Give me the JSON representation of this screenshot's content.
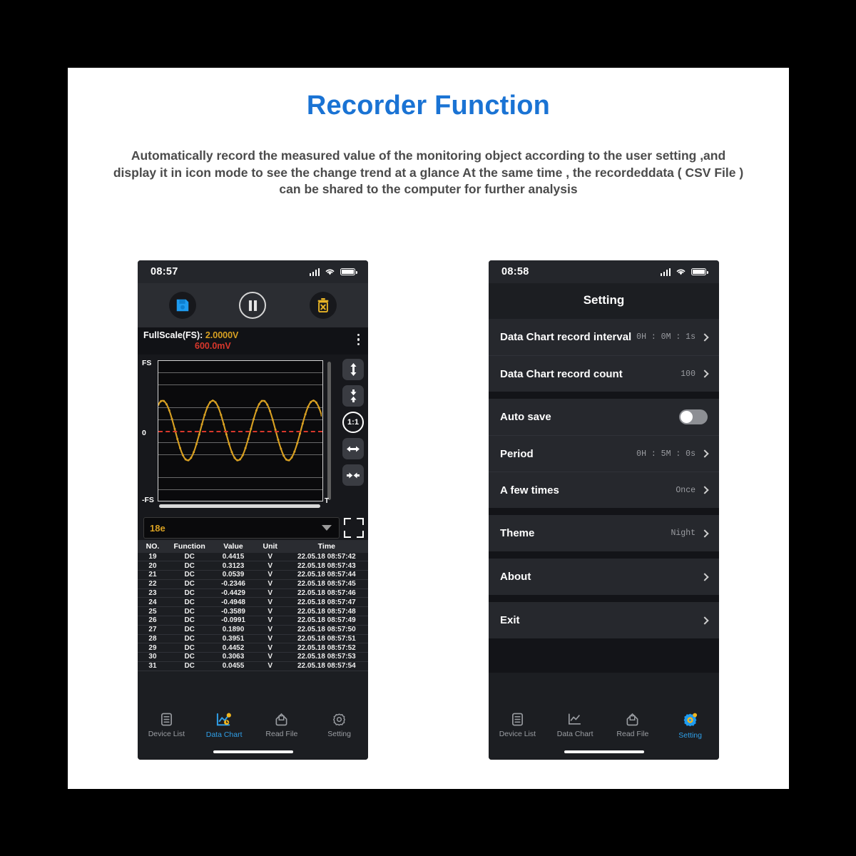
{
  "header": {
    "title": "Recorder Function",
    "description": "Automatically record the measured value of the monitoring object according to the user setting ,and display it in icon mode to see the change trend at a glance At the same time , the recordeddata ( CSV File ) can be shared to the computer for further analysis",
    "title_color": "#1a73d4"
  },
  "phone_left": {
    "status": {
      "time": "08:57",
      "signal_icon": "signal-bars-icon",
      "wifi_icon": "wifi-icon",
      "battery_icon": "battery-icon"
    },
    "toolbar": {
      "save_label": "save-icon",
      "pause_label": "pause-icon",
      "delete_label": "delete-icon"
    },
    "fullscale": {
      "label": "FullScale(FS):",
      "value": "2.0000V",
      "value_color": "#d8a022",
      "sub_value": "600.0mV",
      "sub_color": "#d8372b",
      "menu_icon": "kebab-menu-icon"
    },
    "chart": {
      "y_top": "FS",
      "y_zero": "0",
      "y_bottom": "-FS",
      "x_axis": "T",
      "controls": [
        {
          "name": "vertical-expand-button",
          "glyph": "up-down-arrows-icon"
        },
        {
          "name": "vertical-shrink-button",
          "glyph": "down-up-arrows-icon"
        },
        {
          "name": "ratio-reset-button",
          "glyph": "1:1"
        },
        {
          "name": "horizontal-expand-button",
          "glyph": "left-right-arrows-icon"
        },
        {
          "name": "horizontal-shrink-button",
          "glyph": "right-left-arrows-icon"
        }
      ]
    },
    "selector": {
      "value": "18e",
      "fullscreen_icon": "fullscreen-expand-icon"
    },
    "table": {
      "columns": [
        "NO.",
        "Function",
        "Value",
        "Unit",
        "Time"
      ],
      "rows": [
        [
          "19",
          "DC",
          "0.4415",
          "V",
          "22.05.18 08:57:42"
        ],
        [
          "20",
          "DC",
          "0.3123",
          "V",
          "22.05.18 08:57:43"
        ],
        [
          "21",
          "DC",
          "0.0539",
          "V",
          "22.05.18 08:57:44"
        ],
        [
          "22",
          "DC",
          "-0.2346",
          "V",
          "22.05.18 08:57:45"
        ],
        [
          "23",
          "DC",
          "-0.4429",
          "V",
          "22.05.18 08:57:46"
        ],
        [
          "24",
          "DC",
          "-0.4948",
          "V",
          "22.05.18 08:57:47"
        ],
        [
          "25",
          "DC",
          "-0.3589",
          "V",
          "22.05.18 08:57:48"
        ],
        [
          "26",
          "DC",
          "-0.0991",
          "V",
          "22.05.18 08:57:49"
        ],
        [
          "27",
          "DC",
          "0.1890",
          "V",
          "22.05.18 08:57:50"
        ],
        [
          "28",
          "DC",
          "0.3951",
          "V",
          "22.05.18 08:57:51"
        ],
        [
          "29",
          "DC",
          "0.4452",
          "V",
          "22.05.18 08:57:52"
        ],
        [
          "30",
          "DC",
          "0.3063",
          "V",
          "22.05.18 08:57:53"
        ],
        [
          "31",
          "DC",
          "0.0455",
          "V",
          "22.05.18 08:57:54"
        ]
      ]
    },
    "tabs": [
      {
        "label": "Device List",
        "icon": "device-list-icon",
        "active": false
      },
      {
        "label": "Data Chart",
        "icon": "data-chart-icon",
        "active": true
      },
      {
        "label": "Read File",
        "icon": "read-file-icon",
        "active": false
      },
      {
        "label": "Setting",
        "icon": "gear-icon",
        "active": false
      }
    ]
  },
  "phone_right": {
    "status": {
      "time": "08:58",
      "signal_icon": "signal-bars-icon",
      "wifi_icon": "wifi-icon",
      "battery_icon": "battery-icon"
    },
    "title": "Setting",
    "groups": [
      {
        "rows": [
          {
            "label": "Data Chart record interval",
            "value": "0H : 0M : 1s",
            "type": "chevron"
          },
          {
            "label": "Data Chart record count",
            "value": "100",
            "type": "chevron"
          }
        ]
      },
      {
        "rows": [
          {
            "label": "Auto save",
            "value": "",
            "type": "toggle",
            "toggle_on": false
          },
          {
            "label": "Period",
            "value": "0H : 5M : 0s",
            "type": "chevron"
          },
          {
            "label": "A few times",
            "value": "Once",
            "type": "chevron"
          }
        ]
      },
      {
        "rows": [
          {
            "label": "Theme",
            "value": "Night",
            "type": "chevron"
          }
        ]
      },
      {
        "rows": [
          {
            "label": "About",
            "value": "",
            "type": "chevron"
          }
        ]
      },
      {
        "rows": [
          {
            "label": "Exit",
            "value": "",
            "type": "chevron"
          }
        ]
      }
    ],
    "tabs": [
      {
        "label": "Device List",
        "icon": "device-list-icon",
        "active": false
      },
      {
        "label": "Data Chart",
        "icon": "data-chart-icon",
        "active": false
      },
      {
        "label": "Read File",
        "icon": "read-file-icon",
        "active": false
      },
      {
        "label": "Setting",
        "icon": "gear-icon",
        "active": true
      }
    ]
  },
  "chart_data": {
    "type": "line",
    "title": "",
    "xlabel": "T",
    "ylabel": "",
    "ylim": [
      -1,
      1
    ],
    "y_ticks": [
      "FS",
      "0",
      "-FS"
    ],
    "gridlines": 11,
    "series": [
      {
        "name": "measured-signal",
        "color": "#d8a022",
        "shape": "sine",
        "cycles": 3.25,
        "amplitude": 0.5,
        "phase_deg": 60,
        "points": 120
      },
      {
        "name": "zero-reference",
        "color": "#d8372b",
        "style": "dashed",
        "value": 0
      }
    ]
  }
}
